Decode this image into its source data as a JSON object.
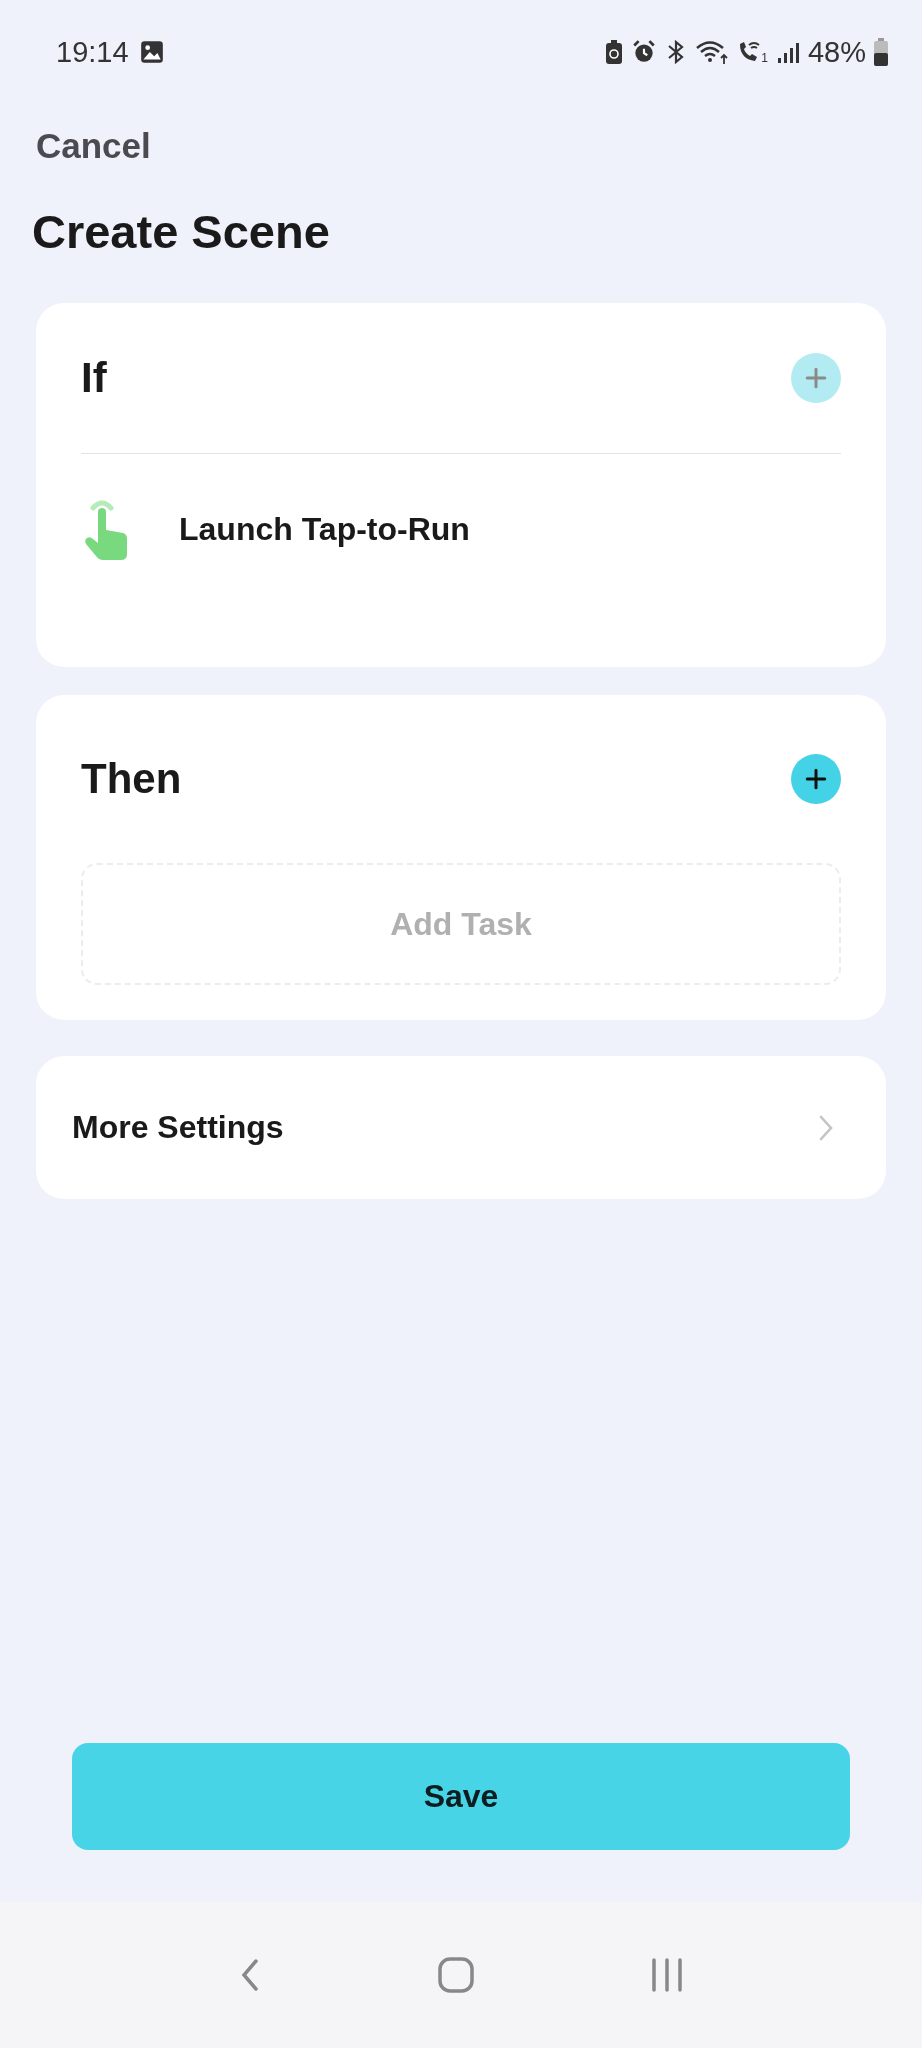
{
  "status_bar": {
    "time": "19:14",
    "sim_slot": "1",
    "battery_percent": "48%"
  },
  "header": {
    "cancel": "Cancel",
    "title": "Create Scene"
  },
  "if_section": {
    "title": "If",
    "add_disabled": true,
    "conditions": [
      {
        "kind": "tap",
        "label": "Launch Tap-to-Run"
      }
    ]
  },
  "then_section": {
    "title": "Then",
    "add_disabled": false,
    "placeholder": "Add Task"
  },
  "more_settings": {
    "label": "More Settings"
  },
  "save_button": "Save"
}
